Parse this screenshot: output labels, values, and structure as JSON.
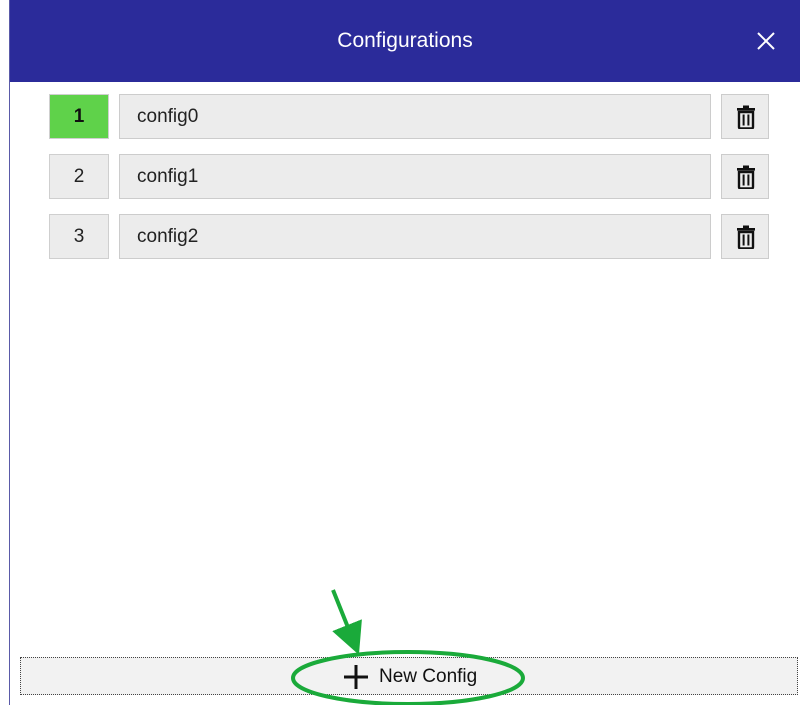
{
  "window": {
    "title": "Configurations",
    "close_icon": "close-icon",
    "titlebar_color": "#2b2b9a"
  },
  "configs": [
    {
      "index": "1",
      "name": "config0",
      "active": true
    },
    {
      "index": "2",
      "name": "config1",
      "active": false
    },
    {
      "index": "3",
      "name": "config2",
      "active": false
    }
  ],
  "footer": {
    "new_config_label": "New Config",
    "new_config_icon": "plus-icon"
  },
  "colors": {
    "active_index": "#5fd24a",
    "annotation": "#1aaa3a"
  }
}
